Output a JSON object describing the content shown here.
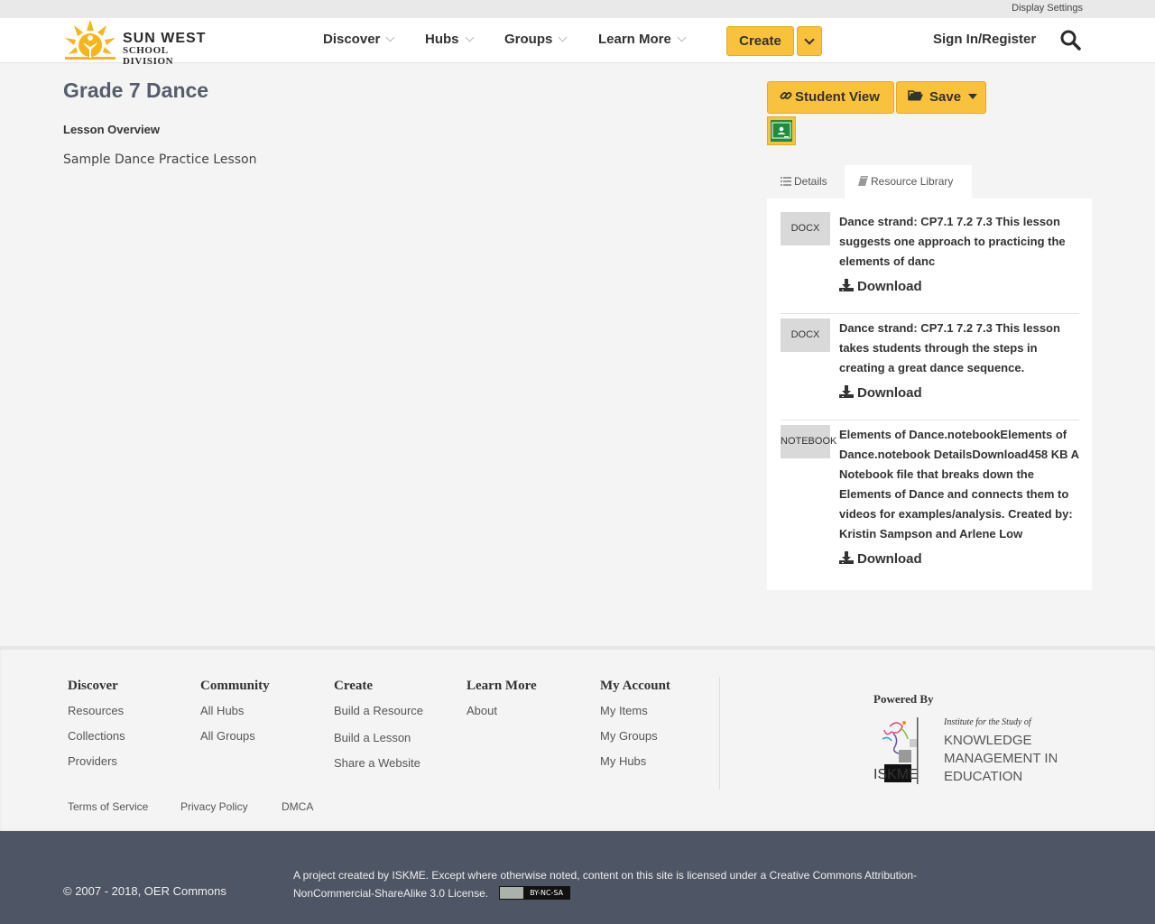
{
  "topbar": {
    "display_settings": "Display Settings"
  },
  "header": {
    "logo_line1": "SUN WEST",
    "logo_line2": "SCHOOL DIVISION",
    "nav": [
      "Discover",
      "Hubs",
      "Groups",
      "Learn More"
    ],
    "create_label": "Create",
    "signin_label": "Sign In/Register"
  },
  "main": {
    "title": "Grade 7 Dance",
    "overview_label": "Lesson Overview",
    "overview_text": "Sample Dance Practice Lesson"
  },
  "actions": {
    "student_view": "Student View",
    "save": "Save"
  },
  "tabs": {
    "details": "Details",
    "library": "Resource Library"
  },
  "resources": [
    {
      "type": "DOCX",
      "title": "Dance strand: CP7.1 7.2 7.3 This lesson suggests one approach to practicing the elements of danc",
      "download": "Download"
    },
    {
      "type": "DOCX",
      "title": "Dance strand: CP7.1 7.2 7.3 This lesson takes students through the steps in creating a great dance sequence.",
      "download": "Download"
    },
    {
      "type": "NOTEBOOK",
      "title": "Elements of Dance.notebookElements of Dance.notebook DetailsDownload458 KB A Notebook file that breaks down the Elements of Dance and connects them to videos for examples/analysis. Created by: Kristin Sampson and Arlene Low",
      "download": "Download"
    }
  ],
  "footer": {
    "discover": {
      "head": "Discover",
      "links": [
        "Resources",
        "Collections",
        "Providers"
      ]
    },
    "community": {
      "head": "Community",
      "links": [
        "All Hubs",
        "All Groups"
      ]
    },
    "create": {
      "head": "Create",
      "links": [
        "Build a Resource",
        "Build a Lesson",
        "Share a Website"
      ]
    },
    "learn_more": {
      "head": "Learn More",
      "links": [
        "About"
      ]
    },
    "my_account": {
      "head": "My Account",
      "links": [
        "My Items",
        "My Groups",
        "My Hubs"
      ]
    },
    "powered_by": "Powered By",
    "iskme_line0": "Institute for the Study of",
    "iskme_line1": "KNOWLEDGE",
    "iskme_line2": "MANAGEMENT IN",
    "iskme_line3": "EDUCATION",
    "iskme_abbr": "ISKME",
    "legal": [
      "Terms of Service",
      "Privacy Policy",
      "DMCA"
    ]
  },
  "bottom": {
    "copyright": "© 2007 - 2018, OER Commons",
    "license": "A project created by ISKME. Except where otherwise noted, content on this site is licensed under a Creative Commons Attribution-NonCommercial-ShareAlike 3.0 License.",
    "cc_badge": "BY-NC-SA"
  },
  "colors": {
    "accent": "#f8c23c",
    "footer_bottom": "#4e5564",
    "title": "#555c6c"
  }
}
